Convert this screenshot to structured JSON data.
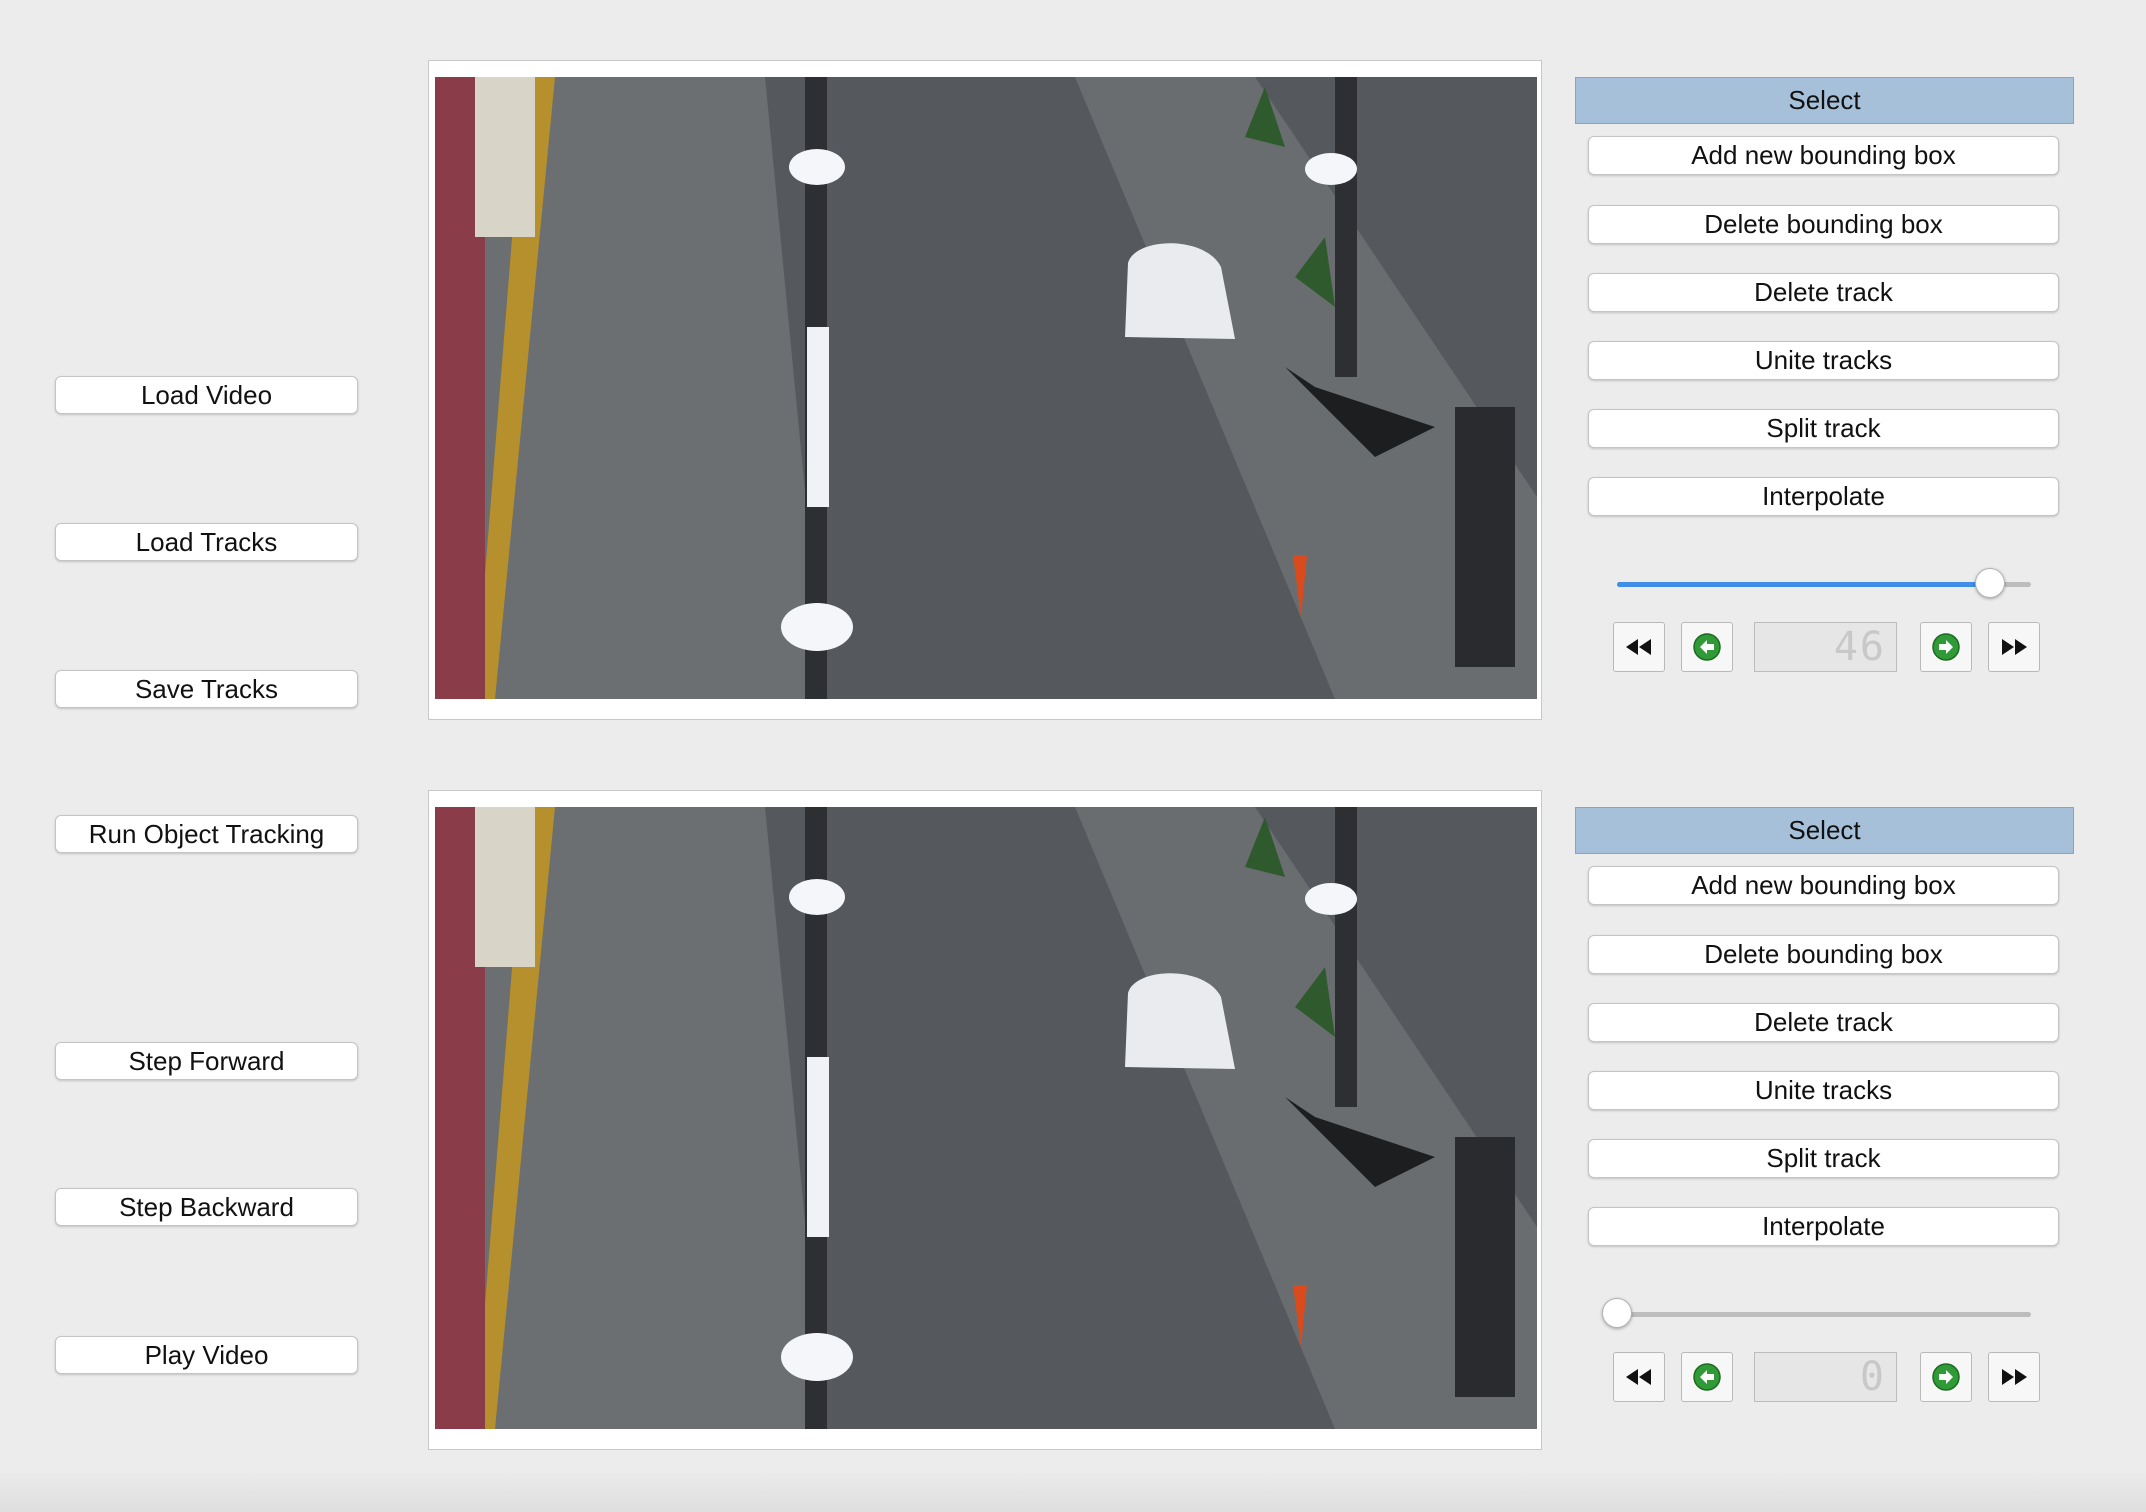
{
  "left_buttons": {
    "load_video": "Load Video",
    "load_tracks": "Load Tracks",
    "save_tracks": "Save Tracks",
    "run_tracking": "Run Object Tracking",
    "step_forward": "Step Forward",
    "step_backward": "Step Backward",
    "play_video": "Play Video"
  },
  "top_panel": {
    "select": "Select",
    "add_box": "Add new bounding box",
    "delete_box": "Delete bounding box",
    "delete_track": "Delete track",
    "unite_tracks": "Unite tracks",
    "split_track": "Split track",
    "interpolate": "Interpolate",
    "frame_number": "46",
    "slider_fraction": 0.9
  },
  "bottom_panel": {
    "select": "Select",
    "add_box": "Add new bounding box",
    "delete_box": "Delete bounding box",
    "delete_track": "Delete track",
    "unite_tracks": "Unite tracks",
    "split_track": "Split track",
    "interpolate": "Interpolate",
    "frame_number": "0",
    "slider_fraction": 0.0
  },
  "icons": {
    "rewind": "rewind-icon",
    "back": "back-arrow-icon",
    "forward": "forward-arrow-icon",
    "fast_forward": "fast-forward-icon"
  },
  "colors": {
    "select_bg": "#a7c0da",
    "slider_fill": "#3f8ee8",
    "nav_arrow_green": "#2f9a36"
  }
}
